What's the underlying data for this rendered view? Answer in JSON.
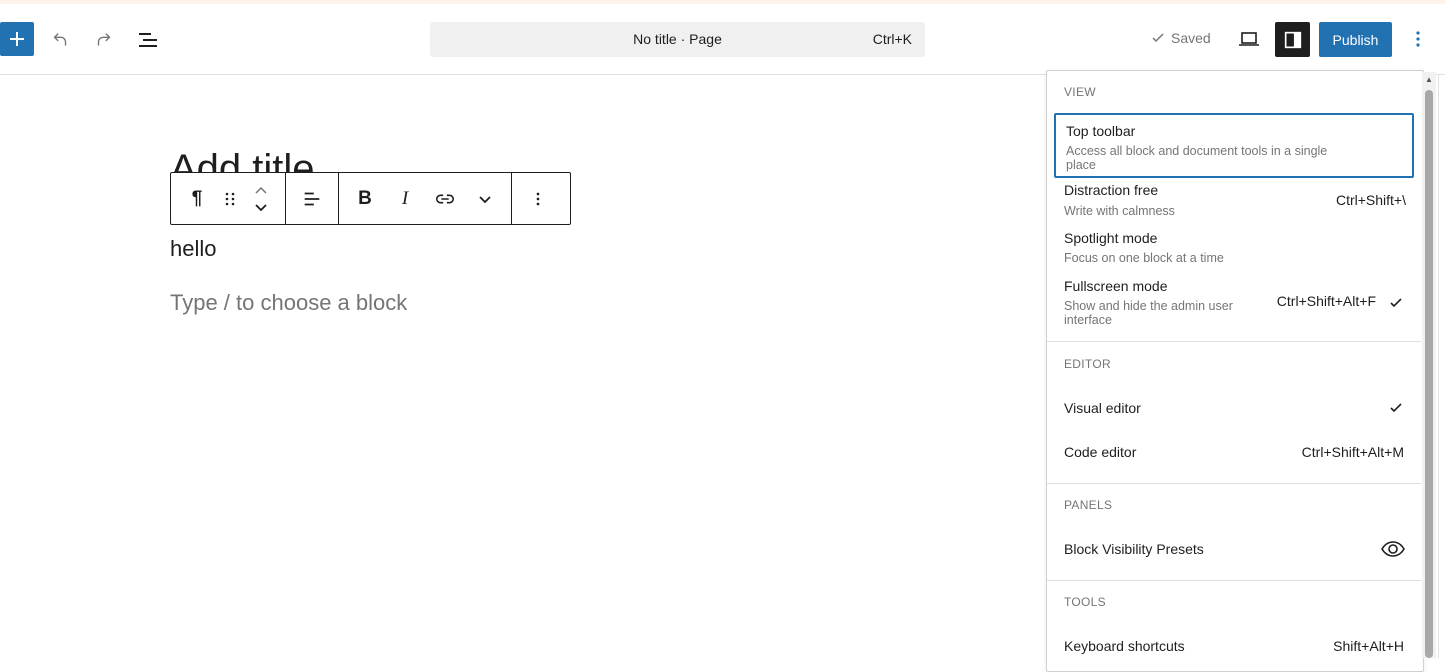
{
  "header": {
    "add_block_label": "+",
    "command_bar": {
      "title": "No title · Page",
      "shortcut": "Ctrl+K"
    },
    "saved_label": "Saved",
    "publish_label": "Publish"
  },
  "editor": {
    "title_placeholder": "Add title",
    "paragraph_text": "hello",
    "block_placeholder": "Type / to choose a block"
  },
  "block_toolbar": {
    "paragraph_glyph": "¶",
    "bold_glyph": "B",
    "italic_glyph": "I"
  },
  "options_menu": {
    "view": {
      "heading": "VIEW",
      "items": [
        {
          "label": "Top toolbar",
          "description": "Access all block and document tools in a single place",
          "shortcut": ""
        },
        {
          "label": "Distraction free",
          "description": "Write with calmness",
          "shortcut": "Ctrl+Shift+\\"
        },
        {
          "label": "Spotlight mode",
          "description": "Focus on one block at a time",
          "shortcut": ""
        },
        {
          "label": "Fullscreen mode",
          "description": "Show and hide the admin user interface",
          "shortcut": "Ctrl+Shift+Alt+F",
          "checked": true
        }
      ]
    },
    "editor": {
      "heading": "EDITOR",
      "items": [
        {
          "label": "Visual editor",
          "shortcut": "",
          "checked": true
        },
        {
          "label": "Code editor",
          "shortcut": "Ctrl+Shift+Alt+M"
        }
      ]
    },
    "panels": {
      "heading": "PANELS",
      "items": [
        {
          "label": "Block Visibility Presets",
          "icon": "eye-icon"
        }
      ]
    },
    "tools": {
      "heading": "TOOLS",
      "items": [
        {
          "label": "Keyboard shortcuts",
          "shortcut": "Shift+Alt+H"
        }
      ]
    }
  },
  "colors": {
    "accent": "#2271b1",
    "dark": "#1e1e1e",
    "muted": "#757575"
  }
}
